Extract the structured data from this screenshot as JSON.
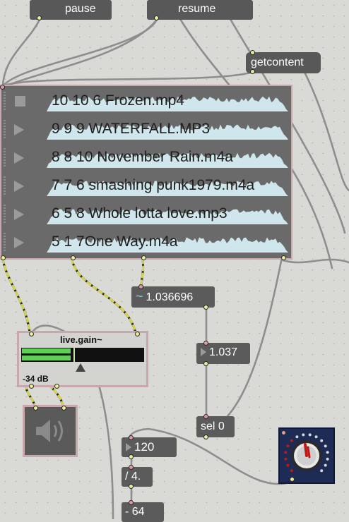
{
  "messages": {
    "pause": "pause",
    "resume": "resume",
    "getcontent": "getcontent"
  },
  "playlist": {
    "items": [
      {
        "label": "10 10 6 Frozen.mp4",
        "state": "stop"
      },
      {
        "label": "9 9 9 WATERFALL.MP3",
        "state": "play"
      },
      {
        "label": "8 8 10 November Rain.m4a",
        "state": "play"
      },
      {
        "label": "7 7 6 smashing punk1979.m4a",
        "state": "play"
      },
      {
        "label": "6 5 8 Whole lotta love.mp3",
        "state": "play"
      },
      {
        "label": "5 1 7One Way.m4a",
        "state": "play"
      }
    ]
  },
  "flonum": {
    "value": "1.036696",
    "icon": "tilde-icon"
  },
  "number_rounded": {
    "value": "1.037"
  },
  "sel": {
    "label": "sel 0"
  },
  "gain": {
    "title": "live.gain~",
    "value": "-34 dB",
    "level": 0.4
  },
  "tempo": {
    "value": "120"
  },
  "divide": {
    "label": "/ 4."
  },
  "subtract": {
    "label": "- 64"
  },
  "colors": {
    "selection_border": "#caa7ad",
    "meter_green": "#5fcf5a",
    "patch_cord_yellow": "#d4d44a",
    "dial_needle": "#c01818"
  }
}
